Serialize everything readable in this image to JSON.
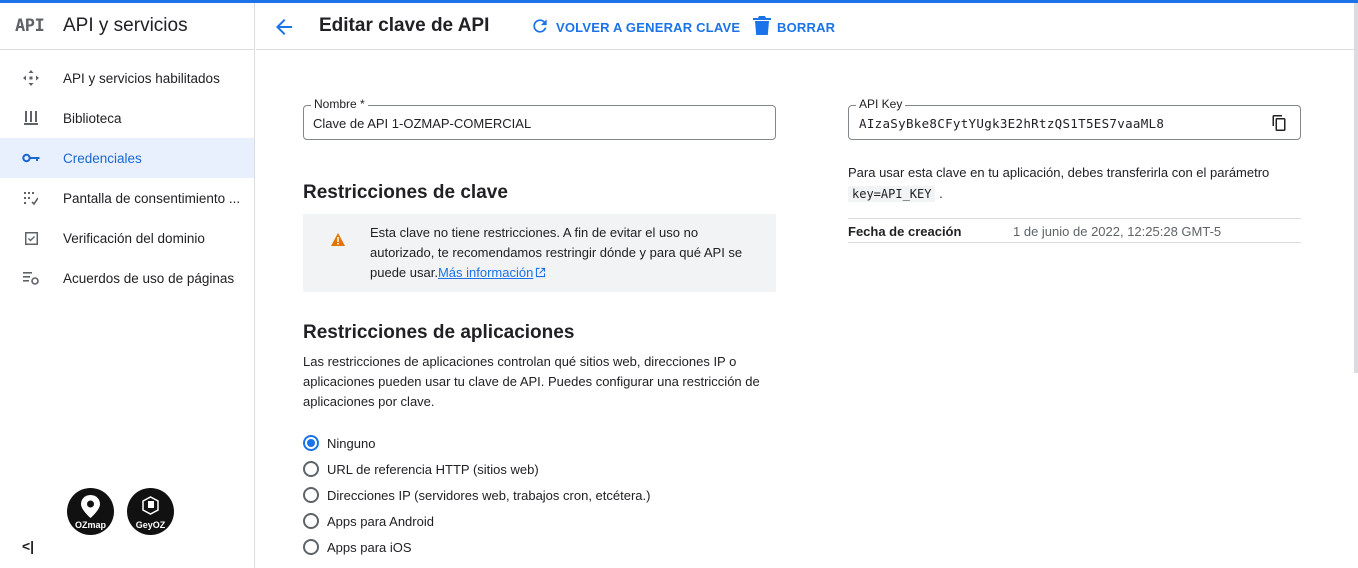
{
  "app": {
    "logo_text": "API",
    "title": "API y servicios"
  },
  "sidebar": {
    "items": [
      {
        "label": "API y servicios habilitados",
        "icon": "diamond-arrows-icon",
        "active": false
      },
      {
        "label": "Biblioteca",
        "icon": "library-icon",
        "active": false
      },
      {
        "label": "Credenciales",
        "icon": "key-icon",
        "active": true
      },
      {
        "label": "Pantalla de consentimiento ...",
        "icon": "consent-icon",
        "active": false
      },
      {
        "label": "Verificación del dominio",
        "icon": "checkbox-icon",
        "active": false
      },
      {
        "label": "Acuerdos de uso de páginas",
        "icon": "settings-list-icon",
        "active": false
      }
    ],
    "logos": [
      {
        "text": "OZmap"
      },
      {
        "text": "GeyOZ"
      }
    ],
    "collapse_label": "<|"
  },
  "header": {
    "title": "Editar clave de API",
    "regenerate_label": "VOLVER A GENERAR CLAVE",
    "delete_label": "BORRAR"
  },
  "form": {
    "name_label": "Nombre *",
    "name_value": "Clave de API 1-OZMAP-COMERCIAL"
  },
  "key_restrictions": {
    "heading": "Restricciones de clave",
    "warning_text": "Esta clave no tiene restricciones. A fin de evitar el uso no autorizado, te recomendamos restringir dónde y para qué API se puede usar.",
    "warning_link": "Más información"
  },
  "app_restrictions": {
    "heading": "Restricciones de aplicaciones",
    "description": "Las restricciones de aplicaciones controlan qué sitios web, direcciones IP o aplicaciones pueden usar tu clave de API. Puedes configurar una restricción de aplicaciones por clave.",
    "options": [
      {
        "label": "Ninguno",
        "checked": true
      },
      {
        "label": "URL de referencia HTTP (sitios web)",
        "checked": false
      },
      {
        "label": "Direcciones IP (servidores web, trabajos cron, etcétera.)",
        "checked": false
      },
      {
        "label": "Apps para Android",
        "checked": false
      },
      {
        "label": "Apps para iOS",
        "checked": false
      }
    ]
  },
  "api_key": {
    "label": "API Key",
    "value": "AIzaSyBke8CFytYUgk3E2hRtzQS1T5ES7vaaML8",
    "usage_text": "Para usar esta clave en tu aplicación, debes transferirla con el parámetro",
    "param": "key=API_KEY",
    "param_suffix": ".",
    "created_label": "Fecha de creación",
    "created_value": "1 de junio de 2022, 12:25:28 GMT-5"
  },
  "colors": {
    "accent": "#1a73e8",
    "active_bg": "#e8f0fe",
    "warning": "#e37400"
  }
}
